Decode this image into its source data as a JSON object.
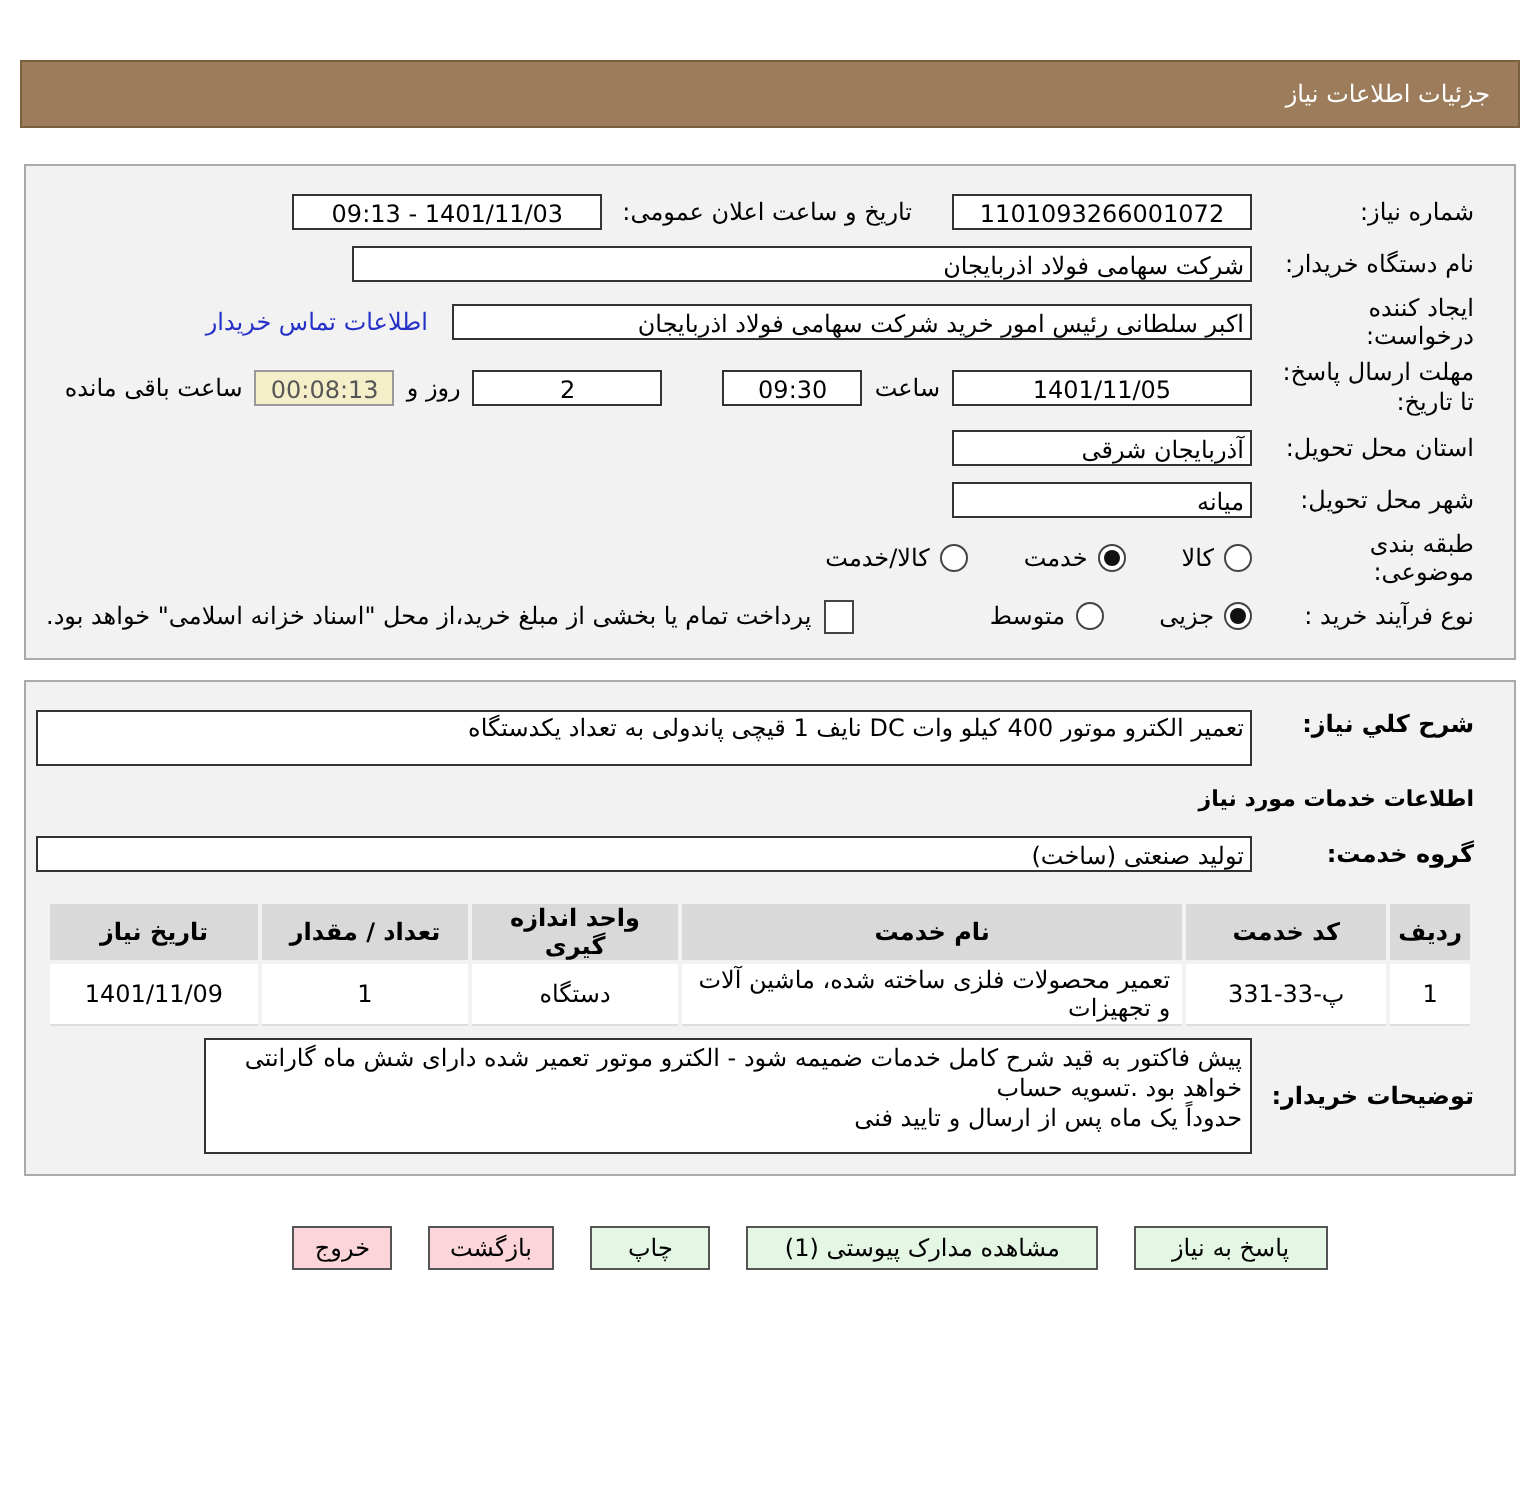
{
  "header": {
    "title": "جزئیات اطلاعات نیاز"
  },
  "need_number": {
    "label": "شماره نیاز:",
    "value": "1101093266001072"
  },
  "announce": {
    "label": "تاریخ و ساعت اعلان عمومی:",
    "value": "1401/11/03 - 09:13"
  },
  "buyer_org": {
    "label": "نام دستگاه خریدار:",
    "value": "شرکت سهامی فولاد اذربایجان"
  },
  "requester": {
    "label": "ایجاد کننده درخواست:",
    "value": "اکبر سلطانی رئیس امور خرید شرکت سهامی فولاد اذربایجان",
    "link": "اطلاعات تماس خریدار"
  },
  "deadline": {
    "label": "مهلت ارسال پاسخ: تا تاریخ:",
    "date": "1401/11/05",
    "time_label": "ساعت",
    "time": "09:30",
    "days": "2",
    "days_label": "روز و",
    "remaining": "00:08:13",
    "remaining_label": "ساعت باقی مانده"
  },
  "province": {
    "label": "استان محل تحویل:",
    "value": "آذربایجان شرقی"
  },
  "city": {
    "label": "شهر محل تحویل:",
    "value": "میانه"
  },
  "category": {
    "label": "طبقه بندی موضوعی:",
    "options": [
      {
        "label": "کالا",
        "selected": false
      },
      {
        "label": "خدمت",
        "selected": true
      },
      {
        "label": "کالا/خدمت",
        "selected": false
      }
    ]
  },
  "purchase_type": {
    "label": "نوع فرآیند خرید :",
    "options": [
      {
        "label": "جزیی",
        "selected": true
      },
      {
        "label": "متوسط",
        "selected": false
      }
    ],
    "payment": {
      "checked": false,
      "label": "پرداخت تمام یا بخشی از مبلغ خرید،از محل \"اسناد خزانه اسلامی\" خواهد بود."
    }
  },
  "description": {
    "label": "شرح کلي نياز:",
    "value": "تعمیر الکترو موتور 400 کیلو وات DC  نایف 1 قیچی پاندولی به تعداد یکدستگاه"
  },
  "services_title": "اطلاعات خدمات مورد نیاز",
  "service_group": {
    "label": "گروه خدمت:",
    "value": "تولید صنعتی (ساخت)"
  },
  "table": {
    "columns": [
      "ردیف",
      "کد خدمت",
      "نام خدمت",
      "واحد اندازه گیری",
      "تعداد / مقدار",
      "تاریخ نیاز"
    ],
    "rows": [
      [
        "1",
        "پ-33-331",
        "تعمیر محصولات فلزی ساخته شده، ماشین آلات و تجهیزات",
        "دستگاه",
        "1",
        "1401/11/09"
      ]
    ]
  },
  "buyer_notes": {
    "label": "توضیحات خریدار:",
    "lines": [
      "پیش فاکتور به قید شرح کامل خدمات ضمیمه شود - الکترو موتور تعمیر شده دارای شش ماه گارانتی خواهد بود .تسویه حساب",
      "حدوداً یک ماه پس از ارسال و تایید فنی"
    ]
  },
  "buttons": [
    {
      "label": "پاسخ به نیاز",
      "kind": "primary"
    },
    {
      "label": "مشاهده مدارک پیوستی (1)",
      "kind": "primary"
    },
    {
      "label": "چاپ",
      "kind": "primary"
    },
    {
      "label": "بازگشت",
      "kind": "danger"
    },
    {
      "label": "خروج",
      "kind": "danger"
    }
  ]
}
